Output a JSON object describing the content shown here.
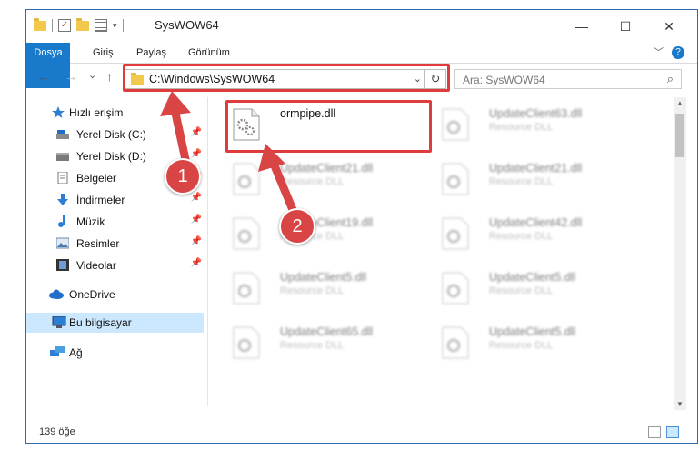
{
  "window": {
    "title": "SysWOW64",
    "buttons": {
      "minimize": "—",
      "maximize": "☐",
      "close": "✕"
    }
  },
  "ribbon": {
    "tabs": [
      "Dosya",
      "Giriş",
      "Paylaş",
      "Görünüm"
    ],
    "expand_chevron": "﹀",
    "help": "?"
  },
  "address": {
    "path": "C:\\Windows\\SysWOW64",
    "dropdown": "⌄",
    "refresh": "↻",
    "back": "←",
    "forward": "→",
    "recent": "⌄",
    "up": "↑"
  },
  "search": {
    "placeholder": "Ara: SysWOW64",
    "icon": "⌕"
  },
  "nav": {
    "items": [
      {
        "label": "Hızlı erişim",
        "icon": "star-icon"
      },
      {
        "label": "Yerel Disk (C:)",
        "icon": "drive-icon",
        "pinned": true
      },
      {
        "label": "Yerel Disk (D:)",
        "icon": "drive-icon",
        "pinned": true
      },
      {
        "label": "Belgeler",
        "icon": "document-icon",
        "pinned": true
      },
      {
        "label": "İndirmeler",
        "icon": "download-icon",
        "pinned": true
      },
      {
        "label": "Müzik",
        "icon": "music-icon",
        "pinned": true
      },
      {
        "label": "Resimler",
        "icon": "pictures-icon",
        "pinned": true
      },
      {
        "label": "Videolar",
        "icon": "video-icon",
        "pinned": true
      },
      {
        "label": "OneDrive",
        "icon": "cloud-icon"
      },
      {
        "label": "Bu bilgisayar",
        "icon": "computer-icon",
        "selected": true
      },
      {
        "label": "Ağ",
        "icon": "network-icon"
      }
    ],
    "pin_glyph": "📌"
  },
  "files": [
    {
      "name": "ormpipe.dll",
      "desc": "",
      "highlighted": true
    },
    {
      "name": "UpdateClient63.dll",
      "desc": "Resource DLL"
    },
    {
      "name": "UpdateClient21.dll",
      "desc": "Resource DLL"
    },
    {
      "name": "UpdateClient21.dll",
      "desc": "Resource DLL"
    },
    {
      "name": "UpdateClient19.dll",
      "desc": "Resource DLL"
    },
    {
      "name": "UpdateClient42.dll",
      "desc": "Resource DLL"
    },
    {
      "name": "UpdateClient5.dll",
      "desc": "Resource DLL"
    },
    {
      "name": "UpdateClient5.dll",
      "desc": "Resource DLL"
    },
    {
      "name": "UpdateClient65.dll",
      "desc": "Resource DLL"
    },
    {
      "name": "UpdateClient5.dll",
      "desc": "Resource DLL"
    }
  ],
  "status": {
    "count": "139 öğe"
  },
  "annotations": {
    "badge1": "1",
    "badge2": "2",
    "color": "#e03c3c"
  },
  "colors": {
    "accent": "#1979ca",
    "selection": "#cce8ff",
    "annotation": "#d94545"
  }
}
